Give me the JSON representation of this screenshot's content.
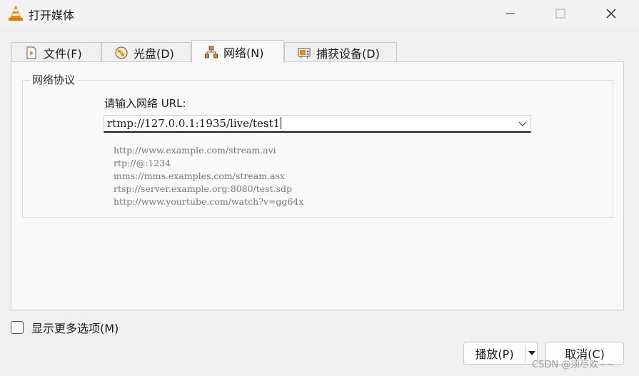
{
  "window": {
    "title": "打开媒体",
    "app_icon": "vlc-cone-icon",
    "controls": [
      "minimize-icon",
      "maximize-icon",
      "close-icon"
    ]
  },
  "tabs": [
    {
      "label": "文件(F)",
      "icon": "file-play-icon",
      "active": false
    },
    {
      "label": "光盘(D)",
      "icon": "disc-icon",
      "active": false
    },
    {
      "label": "网络(N)",
      "icon": "network-icon",
      "active": true
    },
    {
      "label": "捕获设备(D)",
      "icon": "capture-device-icon",
      "active": false
    }
  ],
  "network": {
    "group_title": "网络协议",
    "url_label": "请输入网络 URL:",
    "url_value": "rtmp://127.0.0.1:1935/live/test1",
    "examples": [
      "http://www.example.com/stream.avi",
      "rtp://@:1234",
      "mms://mms.examples.com/stream.asx",
      "rtsp://server.example.org:8080/test.sdp",
      "http://www.yourtube.com/watch?v=gg64x"
    ]
  },
  "options": {
    "show_more_label": "显示更多选项(M)",
    "checked": false
  },
  "buttons": {
    "play_label": "播放(P)",
    "cancel_label": "取消(C)"
  },
  "watermark": "CSDN @须尽欢~~",
  "colors": {
    "accent": "#1a1a1a",
    "vlc_orange": "#f08a00"
  }
}
